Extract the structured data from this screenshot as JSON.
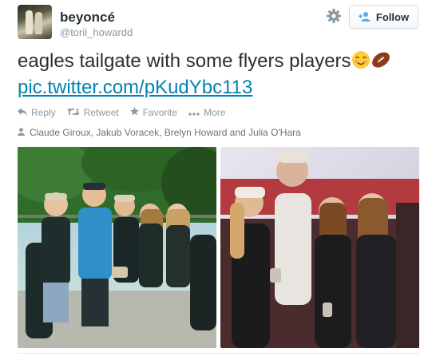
{
  "header": {
    "display_name": "beyoncé",
    "screen_name": "@torii_howardd",
    "follow_label": "Follow"
  },
  "tweet": {
    "text": "eagles tailgate with some flyers players",
    "link": "pic.twitter.com/pKudYbc113"
  },
  "actions": {
    "reply": "Reply",
    "retweet": "Retweet",
    "favorite": "Favorite",
    "more": "More"
  },
  "tagged": {
    "people": "Claude Giroux, Jakub Voracek, Brelyn Howard and Julia O'Hara"
  },
  "colors": {
    "link": "#0084b4",
    "muted": "#8899a6",
    "text": "#292f33"
  },
  "icons": [
    "gear-icon",
    "follow-person-icon",
    "blush-emoji-icon",
    "football-emoji-icon",
    "reply-icon",
    "retweet-icon",
    "favorite-icon",
    "more-icon",
    "person-tag-icon"
  ]
}
